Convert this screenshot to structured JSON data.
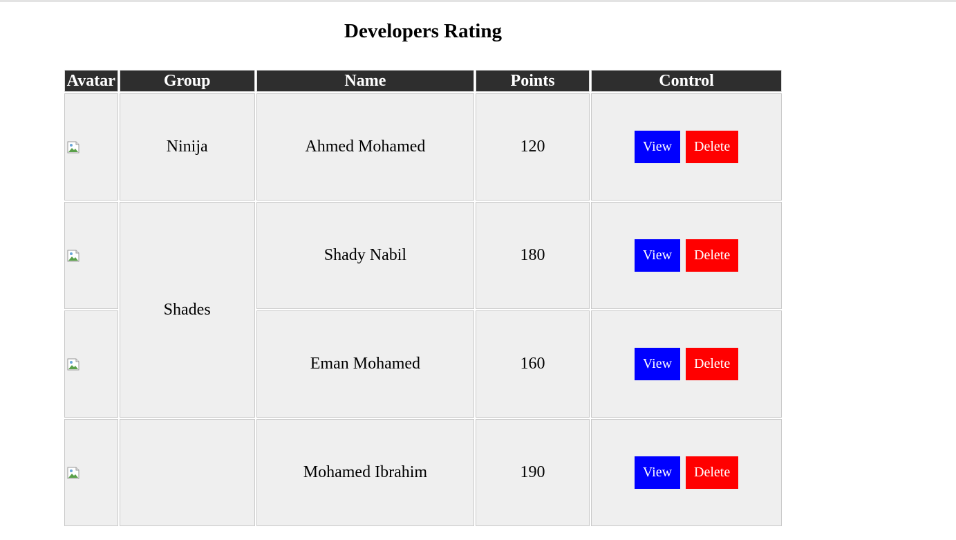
{
  "page": {
    "title": "Developers Rating"
  },
  "table": {
    "headers": [
      "Avatar",
      "Group",
      "Name",
      "Points",
      "Control"
    ],
    "groups": [
      "Ninija",
      "Shades",
      ""
    ],
    "rows": [
      {
        "name": "Ahmed Mohamed",
        "points": "120",
        "view_label": "View",
        "delete_label": "Delete"
      },
      {
        "name": "Shady Nabil",
        "points": "180",
        "view_label": "View",
        "delete_label": "Delete"
      },
      {
        "name": "Eman Mohamed",
        "points": "160",
        "view_label": "View",
        "delete_label": "Delete"
      },
      {
        "name": "Mohamed Ibrahim",
        "points": "190",
        "view_label": "View",
        "delete_label": "Delete"
      }
    ]
  },
  "colors": {
    "header_bg": "#2e2e2e",
    "cell_bg": "#efefef",
    "view_button": "#0000ff",
    "delete_button": "#ff0000"
  },
  "icons": {
    "avatar": "broken-image-icon"
  }
}
